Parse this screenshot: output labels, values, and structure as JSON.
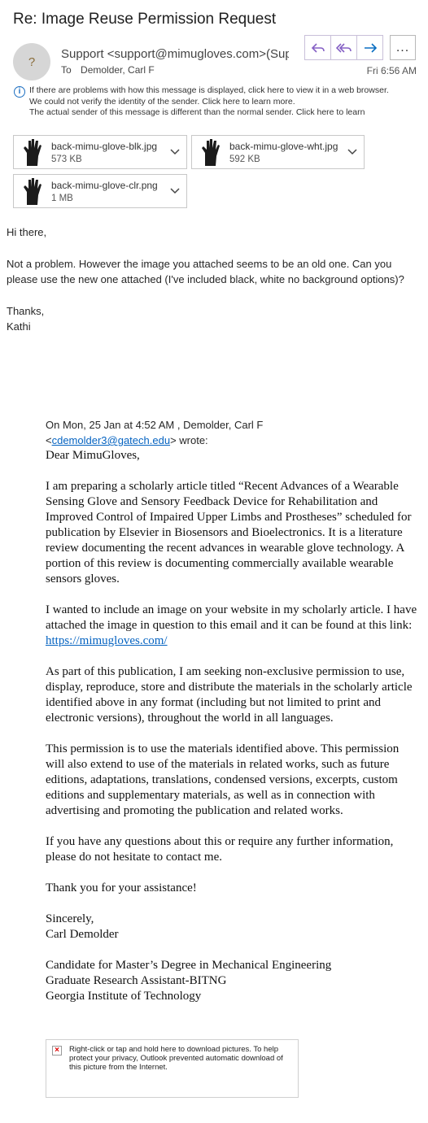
{
  "subject": "Re: Image Reuse Permission Request",
  "sender": {
    "avatar": "?",
    "from": "Support <support@mimugloves.com>(Support",
    "to_label": "To",
    "to": "Demolder, Carl F",
    "date": "Fri 6:56 AM"
  },
  "actions": {
    "reply_icon": "reply-icon",
    "reply_all_icon": "reply-all-icon",
    "forward_icon": "forward-icon",
    "more_label": "..."
  },
  "info": {
    "line1": "If there are problems with how this message is displayed, click here to view it in a web browser.",
    "line2": "We could not verify the identity of the sender. Click here to learn more.",
    "line3": "The actual sender of this message is different than the normal sender. Click here to learn"
  },
  "attachments": [
    {
      "name": "back-mimu-glove-blk.jpg",
      "size": "573 KB"
    },
    {
      "name": "back-mimu-glove-wht.jpg",
      "size": "592 KB"
    },
    {
      "name": "back-mimu-glove-clr.png",
      "size": "1 MB"
    }
  ],
  "body": {
    "greeting": "Hi there,",
    "para1": "Not a problem. However the image you attached seems to be an old one. Can you please use the new one attached (I've included black, white no background options)?",
    "thanks": "Thanks,",
    "signoff": "Kathi"
  },
  "quote_header": {
    "line1": "On Mon, 25 Jan at 4:52 AM , Demolder, Carl F",
    "email_prefix": "<",
    "email": "cdemolder3@gatech.edu",
    "suffix": "> wrote:"
  },
  "quoted": {
    "salutation": "Dear MimuGloves,",
    "p1": "I am preparing a scholarly article titled “Recent Advances of a Wearable Sensing Glove and Sensory Feedback Device for Rehabilitation and Improved Control of Impaired Upper Limbs and Prostheses” scheduled for publication by Elsevier in Biosensors and Bioelectronics. It is a literature review documenting the recent advances in wearable glove technology. A portion of this review is documenting commercially available wearable sensors gloves.",
    "p2": "I wanted to include an image on your website in my scholarly article.  I have attached the image in question to this email and it can be found at this link: ",
    "p2_link": "https://mimugloves.com/",
    "p3": "As part of this publication, I am seeking non-exclusive permission to use, display, reproduce, store and distribute the materials in the scholarly article identified above in any format (including but not limited to print and electronic versions), throughout the world in all languages.",
    "p4": "This permission is to use the materials identified above. This permission will also extend to use of the materials in related works, such as future editions, adaptations, translations, condensed versions, excerpts, custom editions and supplementary materials, as well as in connection with advertising and promoting the publication and related works.",
    "p5": "If you have any questions about this or require any further information, please do not hesitate to contact me.",
    "p6": "Thank you for your assistance!",
    "closing": "Sincerely,",
    "name": "Carl Demolder",
    "title1": "Candidate for Master’s Degree in Mechanical Engineering",
    "title2": "Graduate Research Assistant-BITNG",
    "title3": "Georgia Institute of Technology"
  },
  "blocked_image": {
    "text": "Right-click or tap and hold here to download pictures. To help protect your privacy, Outlook prevented automatic download of this picture from the Internet."
  }
}
